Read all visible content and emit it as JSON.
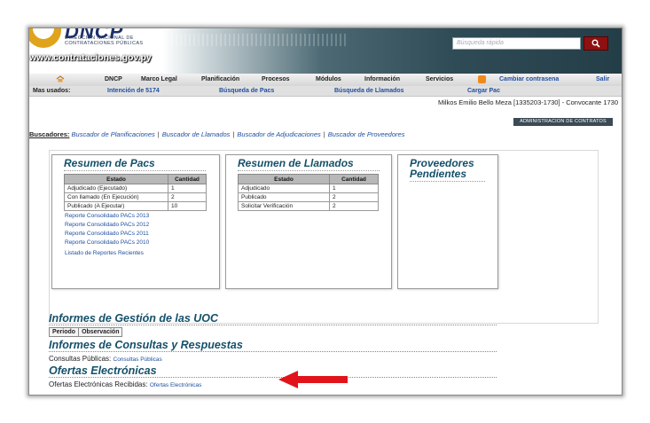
{
  "header": {
    "logo_text": "DNCP",
    "logo_sub_1": "DIRECCIÓN NACIONAL DE",
    "logo_sub_2": "CONTRATACIONES PÚBLICAS",
    "site_url": "www.contrataciones.gov.py",
    "search_placeholder": "Búsqueda rápida"
  },
  "nav": {
    "items": [
      "DNCP",
      "Marco Legal",
      "Planificación",
      "Procesos",
      "Módulos",
      "Información",
      "Servicios"
    ],
    "change_password": "Cambiar contrasena",
    "logout": "Salir"
  },
  "subnav": {
    "label": "Mas usados:",
    "items": [
      "Intención de 5174",
      "Búsqueda de Pacs",
      "Búsqueda de Llamados",
      "Cargar Pac"
    ]
  },
  "user_line": "Milkos Emilio Bello Meza [1335203-1730] - Convocante 1730",
  "admin_button": "ADMINISTRACION DE CONTRATOS",
  "buscadores": {
    "label": "Buscadores:",
    "links": [
      "Buscador de Planificaciones",
      "Buscador de Llamados",
      "Buscador de Adjudicaciones",
      "Buscador de Proveedores"
    ]
  },
  "pacs": {
    "title": "Resumen de Pacs",
    "headers": [
      "Estado",
      "Cantidad"
    ],
    "rows": [
      [
        "Adjudicado (Ejecutado)",
        "1"
      ],
      [
        "Con llamado (En Ejecución)",
        "2"
      ],
      [
        "Publicado (A Ejecutar)",
        "10"
      ]
    ],
    "reports": [
      "Reporte Consolidado PACs 2013",
      "Reporte Consolidado PACs 2012",
      "Reporte Consolidado PACs 2011",
      "Reporte Consolidado PACs 2010"
    ],
    "recent": "Listado de Reportes Recientes"
  },
  "llamados": {
    "title": "Resumen de Llamados",
    "headers": [
      "Estado",
      "Cantidad"
    ],
    "rows": [
      [
        "Adjudicado",
        "1"
      ],
      [
        "Publicado",
        "2"
      ],
      [
        "Solicitar Verificación",
        "2"
      ]
    ]
  },
  "proveedores": {
    "title_1": "Proveedores",
    "title_2": "Pendientes"
  },
  "informes_uoc": {
    "title": "Informes de Gestión de las UOC",
    "headers": [
      "Periodo",
      "Observación"
    ]
  },
  "consultas": {
    "title": "Informes de Consultas y Respuestas",
    "label": "Consultas Públicas:",
    "link": "Consultas Públicas"
  },
  "ofertas": {
    "title": "Ofertas Electrónicas",
    "label": "Ofertas Electrónicas Recibidas:",
    "link": "Ofertas Electrónicas"
  },
  "colors": {
    "accent_title": "#14506a",
    "link": "#1f4fa0",
    "arrow": "#e0141a"
  }
}
